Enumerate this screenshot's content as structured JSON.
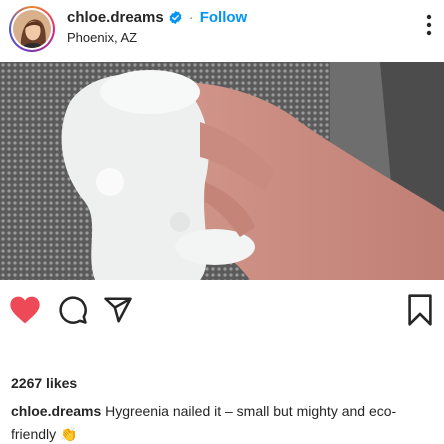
{
  "post": {
    "username": "chloe.dreams",
    "separator": "·",
    "follow_label": "Follow",
    "location": "Phoenix, AZ",
    "likes": "2267 likes",
    "caption_user": "chloe.dreams",
    "caption_text": "Hygreenia nailed it – small but mighty and eco-friendly 👏"
  },
  "icons": {
    "verified": "verified-badge-icon",
    "more": "more-options-icon",
    "like": "heart-icon",
    "comment": "comment-icon",
    "share": "share-icon",
    "save": "bookmark-icon"
  },
  "colors": {
    "accent": "#0095f6",
    "like_active": "#ed4956",
    "text": "#262626"
  }
}
